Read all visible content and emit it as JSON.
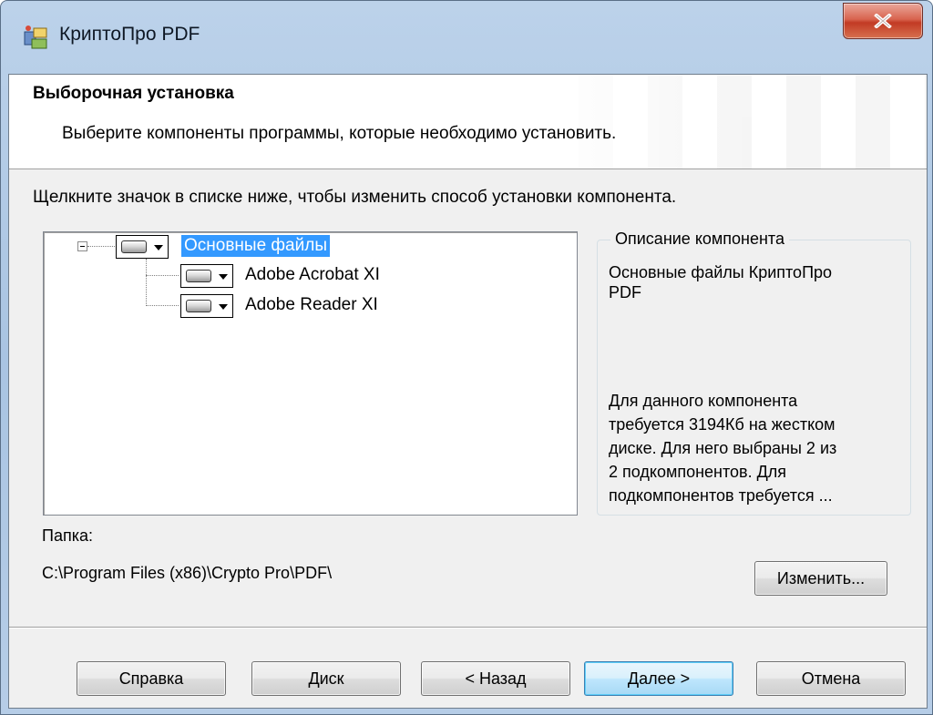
{
  "window": {
    "title": "КриптоПро PDF",
    "close_symbol": "✕"
  },
  "banner": {
    "title": "Выборочная установка",
    "subtitle": "Выберите компоненты программы, которые необходимо установить."
  },
  "instruction": "Щелкните значок в списке ниже, чтобы изменить способ установки компонента.",
  "tree": {
    "nodes": [
      {
        "label": "Основные файлы",
        "selected": true,
        "icon": "hard-drive-icon",
        "expanded": true
      },
      {
        "label": "Adobe Acrobat XI",
        "selected": false,
        "icon": "hard-drive-icon"
      },
      {
        "label": "Adobe Reader XI",
        "selected": false,
        "icon": "hard-drive-icon"
      }
    ]
  },
  "description": {
    "legend": "Описание компонента",
    "line1": "Основные файлы КриптоПро",
    "line2": "PDF",
    "size_lines": [
      "Для данного компонента",
      "требуется 3194Кб на жестком",
      "диске. Для него выбраны 2 из",
      "2 подкомпонентов. Для",
      "подкомпонентов требуется ..."
    ]
  },
  "folder": {
    "label": "Папка:",
    "path": "C:\\Program Files (x86)\\Crypto Pro\\PDF\\",
    "change_button": "Изменить..."
  },
  "buttons": {
    "help": "Справка",
    "disk": "Диск",
    "back": "< Назад",
    "next": "Далее >",
    "cancel": "Отмена"
  },
  "colors": {
    "selection": "#3399ff",
    "default_button_border": "#3c7fb1",
    "close_button": "#c23a24"
  }
}
